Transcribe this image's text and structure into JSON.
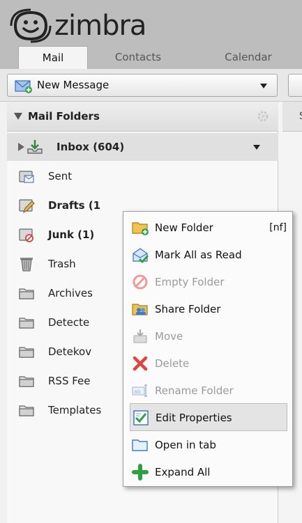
{
  "app": {
    "logo_text": "zimbra"
  },
  "tabs": [
    {
      "label": "Mail"
    },
    {
      "label": "Contacts"
    },
    {
      "label": "Calendar"
    }
  ],
  "toolbar": {
    "new_message_label": "New Message"
  },
  "folders": {
    "header": "Mail Folders",
    "items": [
      {
        "label": "Inbox (604)",
        "icon": "inbox-icon"
      },
      {
        "label": "Sent",
        "icon": "sent-icon"
      },
      {
        "label": "Drafts (1",
        "icon": "drafts-icon"
      },
      {
        "label": "Junk (1)",
        "icon": "junk-icon"
      },
      {
        "label": "Trash",
        "icon": "trash-icon"
      },
      {
        "label": "Archives",
        "icon": "folder-icon"
      },
      {
        "label": "Detecte",
        "icon": "folder-icon"
      },
      {
        "label": "Detekov",
        "icon": "folder-icon"
      },
      {
        "label": "RSS Fee",
        "icon": "folder-icon"
      },
      {
        "label": "Templates",
        "icon": "folder-icon"
      }
    ]
  },
  "right_pane": {
    "partial_label": "S"
  },
  "context_menu": {
    "items": [
      {
        "label": "New Folder",
        "shortcut": "[nf]",
        "icon": "new-folder-icon",
        "enabled": true
      },
      {
        "label": "Mark All as Read",
        "icon": "mark-read-icon",
        "enabled": true
      },
      {
        "label": "Empty Folder",
        "icon": "empty-folder-icon",
        "enabled": false
      },
      {
        "label": "Share Folder",
        "icon": "share-folder-icon",
        "enabled": true
      },
      {
        "label": "Move",
        "icon": "move-icon",
        "enabled": false
      },
      {
        "label": "Delete",
        "icon": "delete-icon",
        "enabled": false
      },
      {
        "label": "Rename Folder",
        "icon": "rename-icon",
        "enabled": false
      },
      {
        "label": "Edit Properties",
        "icon": "edit-properties-icon",
        "enabled": true,
        "hovered": true
      },
      {
        "label": "Open in tab",
        "icon": "open-tab-icon",
        "enabled": true
      },
      {
        "label": "Expand All",
        "icon": "expand-all-icon",
        "enabled": true
      }
    ]
  },
  "colors": {
    "header_bg": "#bdbdbd",
    "panel_bg": "#f8f8f8",
    "folder_yellow": "#f2c14e",
    "accent_blue": "#3b7ccf",
    "delete_red": "#e0443e",
    "expand_green": "#2ea043"
  }
}
